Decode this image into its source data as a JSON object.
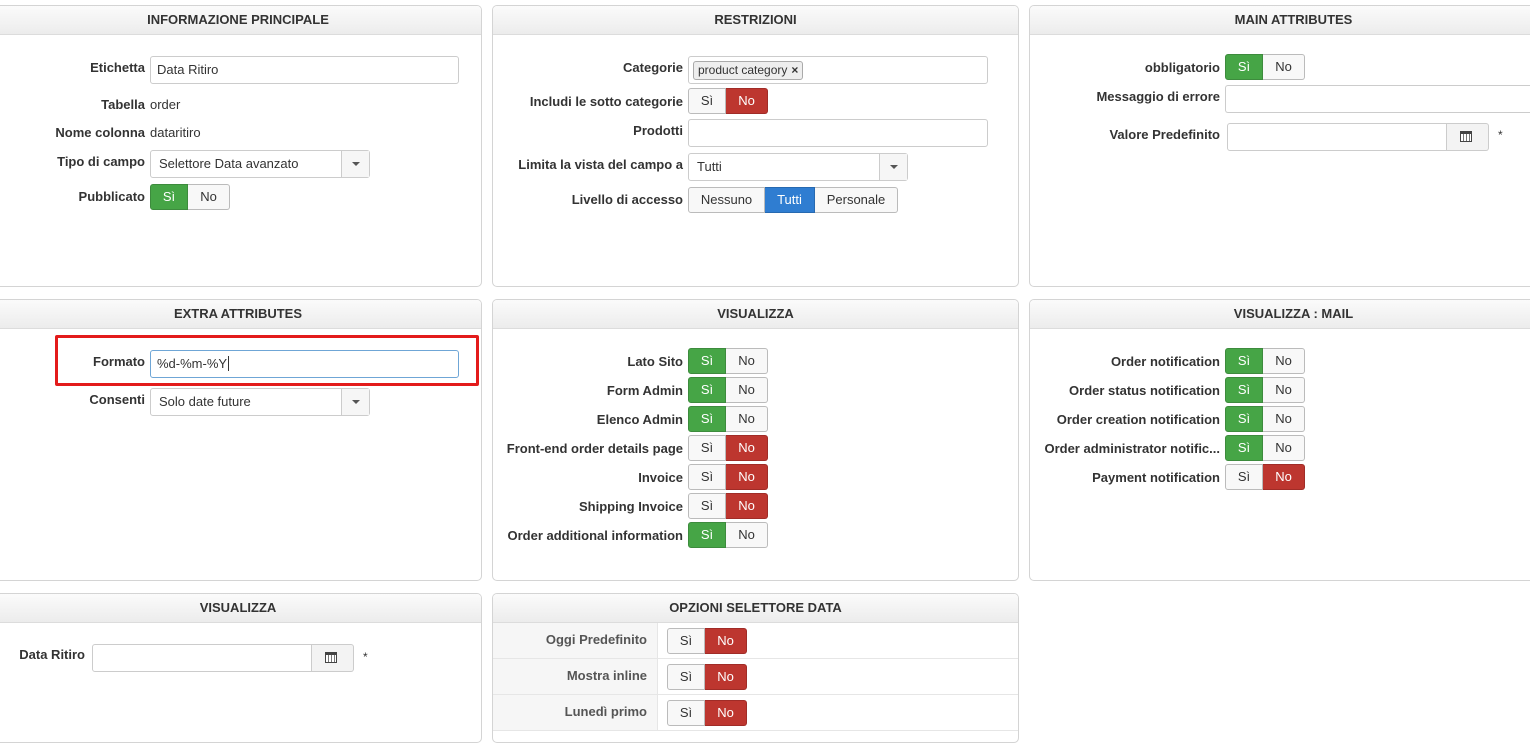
{
  "panels": {
    "info": {
      "title": "INFORMAZIONE PRINCIPALE",
      "etichetta_label": "Etichetta",
      "etichetta_value": "Data Ritiro",
      "tabella_label": "Tabella",
      "tabella_value": "order",
      "nome_colonna_label": "Nome colonna",
      "nome_colonna_value": "dataritiro",
      "tipo_label": "Tipo di campo",
      "tipo_value": "Selettore Data avanzato",
      "pubblicato_label": "Pubblicato",
      "yes": "Sì",
      "no": "No"
    },
    "restrizioni": {
      "title": "RESTRIZIONI",
      "categorie_label": "Categorie",
      "categorie_tag": "product category",
      "sotto_label": "Includi le sotto categorie",
      "yes": "Sì",
      "no": "No",
      "prodotti_label": "Prodotti",
      "limita_label": "Limita la vista del campo a",
      "limita_value": "Tutti",
      "livello_label": "Livello di accesso",
      "livello_options": [
        "Nessuno",
        "Tutti",
        "Personale"
      ]
    },
    "main": {
      "title": "MAIN ATTRIBUTES",
      "obbligatorio_label": "obbligatorio",
      "yes": "Sì",
      "no": "No",
      "messaggio_label": "Messaggio di errore",
      "valore_label": "Valore Predefinito",
      "star": "*"
    },
    "extra": {
      "title": "EXTRA ATTRIBUTES",
      "formato_label": "Formato",
      "formato_value": "%d-%m-%Y",
      "consenti_label": "Consenti",
      "consenti_value": "Solo date future"
    },
    "visualizza": {
      "title": "VISUALIZZA",
      "yes": "Sì",
      "no": "No",
      "rows": [
        {
          "label": "Lato Sito",
          "on": true
        },
        {
          "label": "Form Admin",
          "on": true
        },
        {
          "label": "Elenco Admin",
          "on": true
        },
        {
          "label": "Front-end order details page",
          "on": false
        },
        {
          "label": "Invoice",
          "on": false
        },
        {
          "label": "Shipping Invoice",
          "on": false
        },
        {
          "label": "Order additional information",
          "on": true
        }
      ]
    },
    "mail": {
      "title": "VISUALIZZA : MAIL",
      "yes": "Sì",
      "no": "No",
      "rows": [
        {
          "label": "Order notification",
          "on": true
        },
        {
          "label": "Order status notification",
          "on": true
        },
        {
          "label": "Order creation notification",
          "on": true
        },
        {
          "label": "Order administrator notific...",
          "on": true
        },
        {
          "label": "Payment notification",
          "on": false
        }
      ]
    },
    "preview": {
      "title": "VISUALIZZA",
      "data_label": "Data Ritiro",
      "star": "*"
    },
    "datepicker": {
      "title": "OPZIONI SELETTORE DATA",
      "yes": "Sì",
      "no": "No",
      "rows": [
        {
          "label": "Oggi Predefinito",
          "on": false
        },
        {
          "label": "Mostra inline",
          "on": false
        },
        {
          "label": "Lunedì primo",
          "on": false
        }
      ]
    }
  },
  "colors": {
    "green": "#46a546",
    "red": "#bd362f",
    "blue": "#2f7dd1",
    "highlight": "#e31b1b"
  },
  "icons": {
    "calendar": "calendar-icon",
    "caret": "chevron-down-icon",
    "tag_remove": "close-icon"
  }
}
